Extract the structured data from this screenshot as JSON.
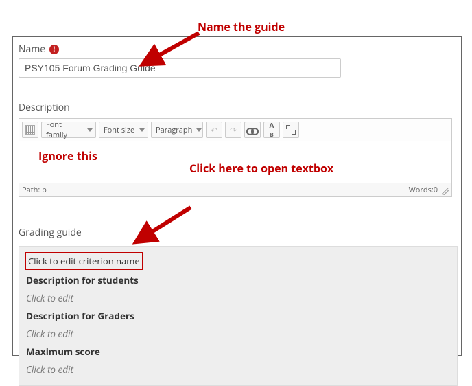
{
  "annotations": {
    "name_guide": "Name the guide",
    "ignore": "Ignore this",
    "click_open": "Click here to open textbox"
  },
  "name": {
    "label": "Name",
    "required_mark": "!",
    "value": "PSY105 Forum Grading Guide"
  },
  "description": {
    "label": "Description",
    "toolbar": {
      "font_family": "Font family",
      "font_size": "Font size",
      "paragraph": "Paragraph"
    },
    "status_path": "Path: p",
    "status_words": "Words:0"
  },
  "grading_guide": {
    "label": "Grading guide",
    "criterion": {
      "name": "Click to edit criterion name",
      "desc_students_label": "Description for students",
      "desc_students_edit": "Click to edit",
      "desc_graders_label": "Description for Graders",
      "desc_graders_edit": "Click to edit",
      "max_score_label": "Maximum score",
      "max_score_edit": "Click to edit"
    }
  }
}
